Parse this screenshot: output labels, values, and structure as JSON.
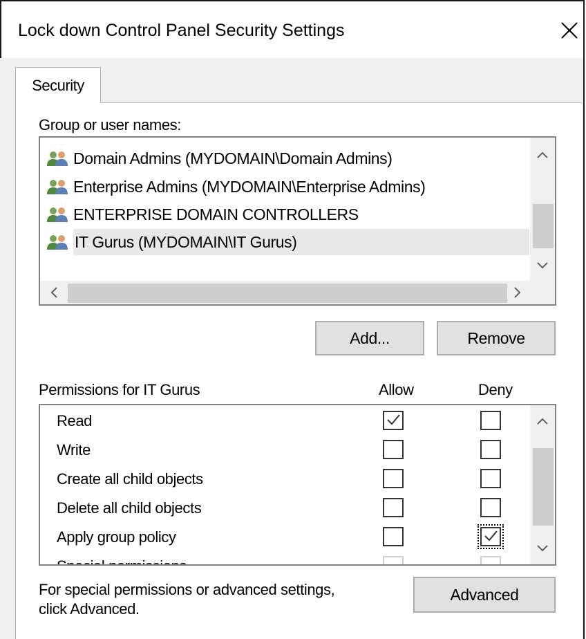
{
  "window": {
    "title": "Lock down Control Panel Security Settings",
    "close_icon": "close-icon"
  },
  "tabs": [
    {
      "label": "Security",
      "active": true
    }
  ],
  "groups": {
    "label": "Group or user names:",
    "items": [
      {
        "icon": "user-group-icon",
        "label": "Domain Admins (MYDOMAIN\\Domain Admins)",
        "selected": false
      },
      {
        "icon": "user-group-icon",
        "label": "Enterprise Admins (MYDOMAIN\\Enterprise Admins)",
        "selected": false
      },
      {
        "icon": "user-group-icon",
        "label": "ENTERPRISE DOMAIN CONTROLLERS",
        "selected": false
      },
      {
        "icon": "user-group-icon",
        "label": "IT Gurus (MYDOMAIN\\IT Gurus)",
        "selected": true
      }
    ]
  },
  "buttons": {
    "add": "Add...",
    "remove": "Remove",
    "advanced": "Advanced"
  },
  "permissions": {
    "label": "Permissions for IT Gurus",
    "allow_header": "Allow",
    "deny_header": "Deny",
    "rows": [
      {
        "name": "Read",
        "allow": true,
        "deny": false
      },
      {
        "name": "Write",
        "allow": false,
        "deny": false
      },
      {
        "name": "Create all child objects",
        "allow": false,
        "deny": false
      },
      {
        "name": "Delete all child objects",
        "allow": false,
        "deny": false
      },
      {
        "name": "Apply group policy",
        "allow": false,
        "deny": true
      },
      {
        "name": "Special permissions",
        "allow": false,
        "deny": false
      }
    ]
  },
  "advanced_note": {
    "line1": "For special permissions or advanced settings,",
    "line2": "click Advanced."
  },
  "colors": {
    "selected_row": "#e8e8e8",
    "button_face": "#e1e1e1",
    "dialog_bg": "#f0f0f0"
  }
}
